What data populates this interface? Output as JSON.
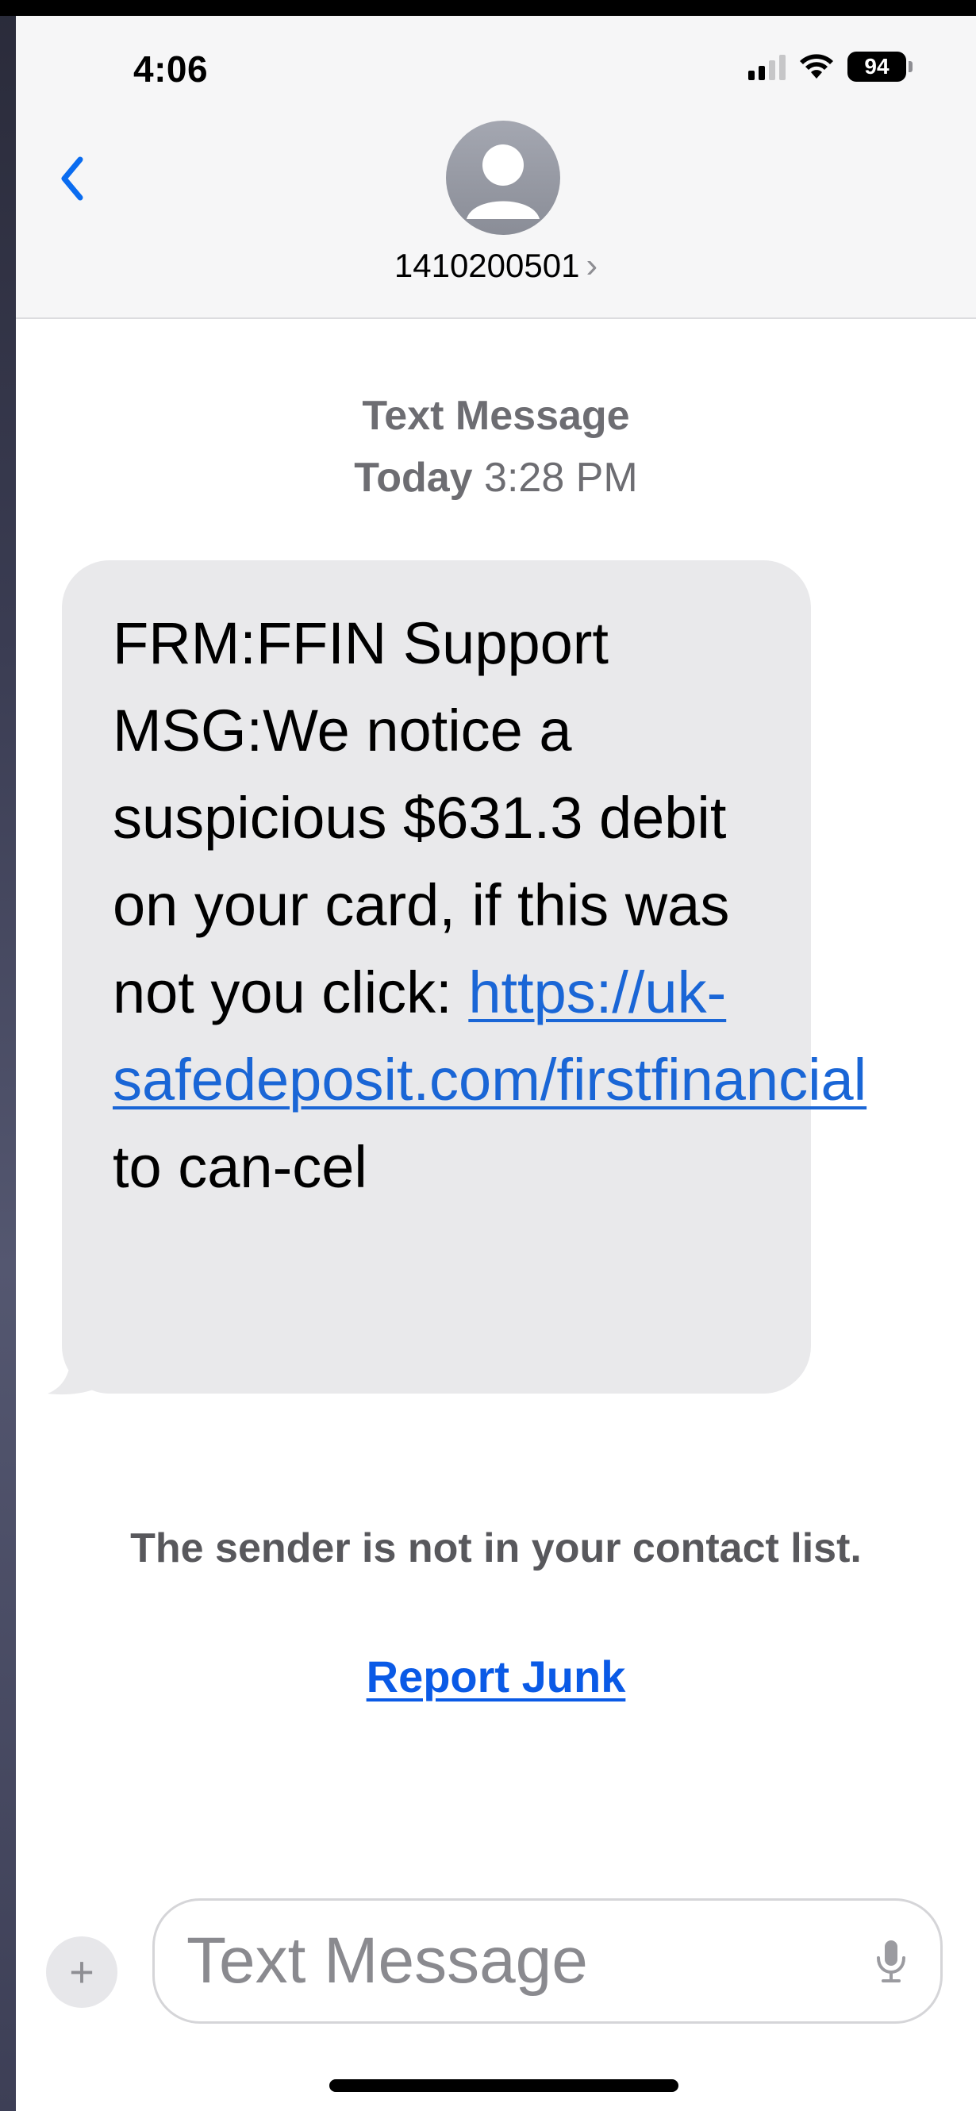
{
  "status_bar": {
    "time": "4:06",
    "battery": "94"
  },
  "header": {
    "contact_name": "1410200501",
    "chevron": "›",
    "back_icon": "chevron-left-icon",
    "avatar_icon": "person-silhouette-icon"
  },
  "conversation": {
    "message_type": "Text Message",
    "date_prefix": "Today",
    "time": "3:28 PM",
    "bubble": {
      "text_before_link": "FRM:FFIN Support MSG:We notice a suspicious $631.3 debit on your card, if this was not you click: ",
      "link": "https://uk-safedeposit.com/firstfinancial",
      "text_after_link": " to can-cel"
    },
    "notice": "The sender is not in your contact list.",
    "report_junk": "Report Junk"
  },
  "composer": {
    "plus": "+",
    "placeholder": "Text Message",
    "mic_icon": "microphone-icon"
  },
  "colors": {
    "link": "#1a66d6",
    "report_link": "#0a5ae6",
    "bubble": "#e9e9eb",
    "header_bg": "#f6f6f7"
  }
}
